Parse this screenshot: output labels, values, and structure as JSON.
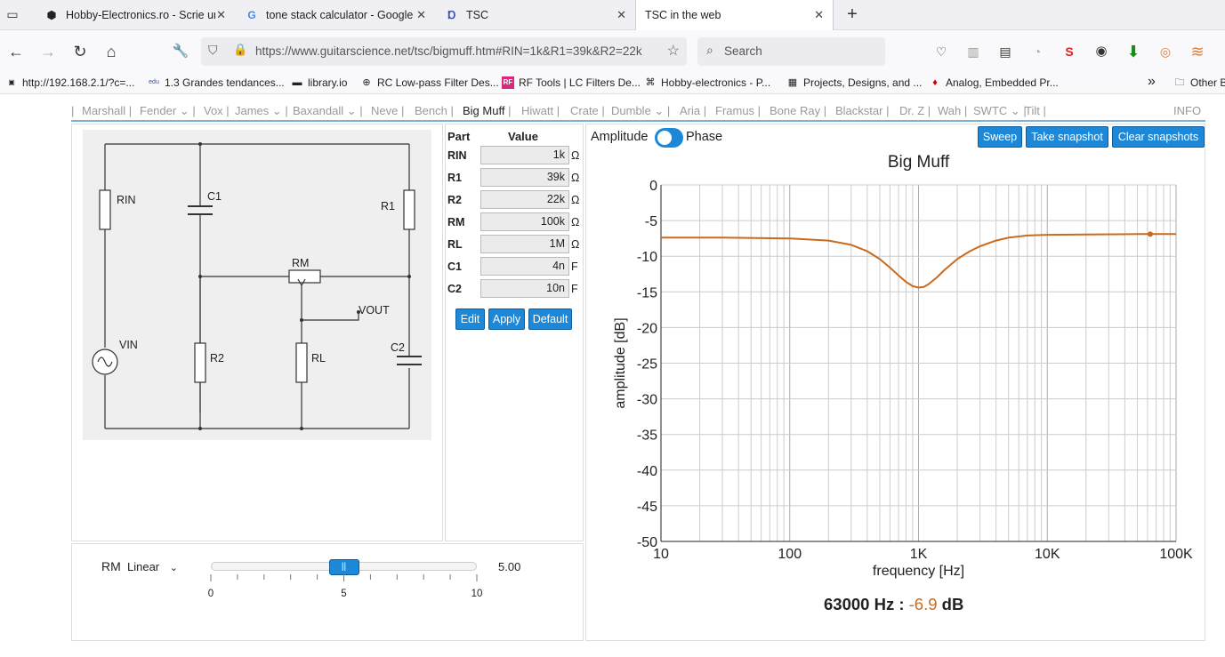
{
  "browser": {
    "tabs": [
      {
        "title": "Hobby-Electronics.ro - Scrie un",
        "icon": "hobby-electronics-favicon"
      },
      {
        "title": "tone stack calculator - Google S",
        "icon": "google-favicon"
      },
      {
        "title": "TSC",
        "icon": "tsc-favicon"
      },
      {
        "title": "TSC in the web",
        "icon": ""
      }
    ],
    "new_tab": "+",
    "url": "https://www.guitarscience.net/tsc/bigmuff.htm#RIN=1k&R1=39k&R2=22k",
    "search_placeholder": "Search",
    "bookmarks": [
      "http://192.168.2.1/?c=...",
      "1.3 Grandes tendances...",
      "library.io",
      "RC Low-pass Filter Des...",
      "RF Tools | LC Filters De...",
      "Hobby-electronics - P...",
      "Projects, Designs, and ...",
      "Analog, Embedded Pr...",
      "Other B"
    ],
    "overflow": "»"
  },
  "menu": {
    "items": [
      {
        "label": "Marshall",
        "dropdown": false
      },
      {
        "label": "Fender",
        "dropdown": true
      },
      {
        "label": "Vox",
        "dropdown": false
      },
      {
        "label": "James",
        "dropdown": true
      },
      {
        "label": "Baxandall",
        "dropdown": true
      },
      {
        "label": "Neve",
        "dropdown": false
      },
      {
        "label": "Bench",
        "dropdown": false
      },
      {
        "label": "Big Muff",
        "dropdown": false
      },
      {
        "label": "Hiwatt",
        "dropdown": false
      },
      {
        "label": "Crate",
        "dropdown": false
      },
      {
        "label": "Dumble",
        "dropdown": true
      },
      {
        "label": "Aria",
        "dropdown": false
      },
      {
        "label": "Framus",
        "dropdown": false
      },
      {
        "label": "Bone Ray",
        "dropdown": false
      },
      {
        "label": "Blackstar",
        "dropdown": false
      },
      {
        "label": "Dr. Z",
        "dropdown": false
      },
      {
        "label": "Wah",
        "dropdown": false
      },
      {
        "label": "SWTC",
        "dropdown": true
      },
      {
        "label": "Tilt",
        "dropdown": false
      }
    ],
    "current": "Big Muff",
    "info": "INFO"
  },
  "schematic": {
    "labels": {
      "rin": "RIN",
      "c1": "C1",
      "r1": "R1",
      "rm": "RM",
      "vout": "VOUT",
      "vin": "VIN",
      "r2": "R2",
      "rl": "RL",
      "c2": "C2"
    }
  },
  "parts": {
    "header_part": "Part",
    "header_value": "Value",
    "rows": [
      {
        "name": "RIN",
        "value": "1k",
        "unit": "Ω"
      },
      {
        "name": "R1",
        "value": "39k",
        "unit": "Ω"
      },
      {
        "name": "R2",
        "value": "22k",
        "unit": "Ω"
      },
      {
        "name": "RM",
        "value": "100k",
        "unit": "Ω"
      },
      {
        "name": "RL",
        "value": "1M",
        "unit": "Ω"
      },
      {
        "name": "C1",
        "value": "4n",
        "unit": "F"
      },
      {
        "name": "C2",
        "value": "10n",
        "unit": "F"
      }
    ],
    "buttons": {
      "edit": "Edit",
      "apply": "Apply",
      "default": "Default"
    }
  },
  "plot_controls": {
    "amplitude": "Amplitude",
    "phase": "Phase",
    "mode": "amplitude",
    "sweep": "Sweep",
    "take_snapshot": "Take snapshot",
    "clear_snapshots": "Clear snapshots"
  },
  "pot": {
    "name": "RM",
    "taper": "Linear",
    "value": 5,
    "value_label": "5.00",
    "min_label": "0",
    "mid_label": "5",
    "max_label": "10"
  },
  "readout": {
    "freq": "63000 Hz :",
    "value": "-6.9",
    "unit": "dB"
  },
  "colors": {
    "accent": "#1e88d8",
    "curve": "#cc6a1c"
  },
  "chart_data": {
    "type": "line",
    "title": "Big Muff",
    "xlabel": "frequency [Hz]",
    "ylabel": "amplitude [dB]",
    "xscale": "log",
    "xlim": [
      10,
      100000
    ],
    "ylim": [
      -50,
      0
    ],
    "xticks": [
      {
        "v": 10,
        "label": "10"
      },
      {
        "v": 100,
        "label": "100"
      },
      {
        "v": 1000,
        "label": "1K"
      },
      {
        "v": 10000,
        "label": "10K"
      },
      {
        "v": 100000,
        "label": "100K"
      }
    ],
    "yticks": [
      0,
      -5,
      -10,
      -15,
      -20,
      -25,
      -30,
      -35,
      -40,
      -45,
      -50
    ],
    "grid": true,
    "series": [
      {
        "x": [
          10,
          30,
          100,
          200,
          300,
          400,
          500,
          600,
          700,
          800,
          900,
          1000,
          1100,
          1200,
          1400,
          1600,
          2000,
          2500,
          3000,
          4000,
          5000,
          7000,
          10000,
          20000,
          50000,
          100000
        ],
        "y": [
          -7.4,
          -7.4,
          -7.5,
          -7.8,
          -8.4,
          -9.3,
          -10.4,
          -11.6,
          -12.7,
          -13.6,
          -14.2,
          -14.4,
          -14.3,
          -13.9,
          -12.9,
          -11.9,
          -10.4,
          -9.3,
          -8.6,
          -7.8,
          -7.4,
          -7.1,
          -7.0,
          -6.95,
          -6.9,
          -6.9
        ]
      }
    ],
    "marker": {
      "x": 63000,
      "y": -6.9
    }
  }
}
